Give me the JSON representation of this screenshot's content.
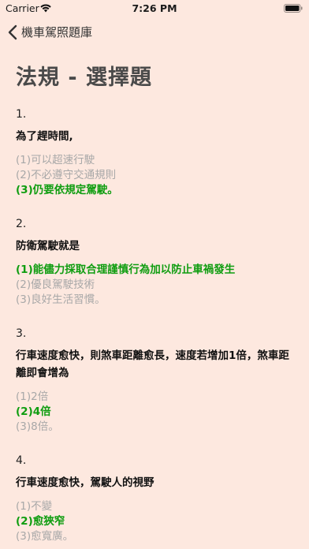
{
  "status_bar": {
    "carrier": "Carrier",
    "time": "7:26 PM",
    "wifi_icon": "wifi-icon",
    "battery_icon": "battery-icon"
  },
  "nav": {
    "back_label": "機車駕照題庫",
    "back_icon": "chevron-left-icon"
  },
  "page_title": "法規 - 選擇題",
  "colors": {
    "background": "#fde8df",
    "correct": "#0f9d10",
    "incorrect": "#a8a8a8",
    "title": "#4a4a4a"
  },
  "questions": [
    {
      "number": "1.",
      "text": "為了趕時間,",
      "options": [
        {
          "text": "(1)可以超速行駛",
          "correct": false
        },
        {
          "text": "(2)不必遵守交通規則",
          "correct": false
        },
        {
          "text": "(3)仍要依規定駕駛。",
          "correct": true
        }
      ]
    },
    {
      "number": "2.",
      "text": "防衛駕駛就是",
      "options": [
        {
          "text": "(1)能儘力採取合理謹慎行為加以防止車禍發生",
          "correct": true
        },
        {
          "text": "(2)優良駕駛技術",
          "correct": false
        },
        {
          "text": "(3)良好生活習慣。",
          "correct": false
        }
      ]
    },
    {
      "number": "3.",
      "text": "行車速度愈快，則煞車距離愈長，速度若增加1倍，煞車距離即會增為",
      "options": [
        {
          "text": "(1)2倍",
          "correct": false
        },
        {
          "text": "(2)4倍",
          "correct": true
        },
        {
          "text": "(3)8倍。",
          "correct": false
        }
      ]
    },
    {
      "number": "4.",
      "text": "行車速度愈快，駕駛人的視野",
      "options": [
        {
          "text": "(1)不變",
          "correct": false
        },
        {
          "text": "(2)愈狹窄",
          "correct": true
        },
        {
          "text": "(3)愈寬廣。",
          "correct": false
        }
      ]
    }
  ]
}
